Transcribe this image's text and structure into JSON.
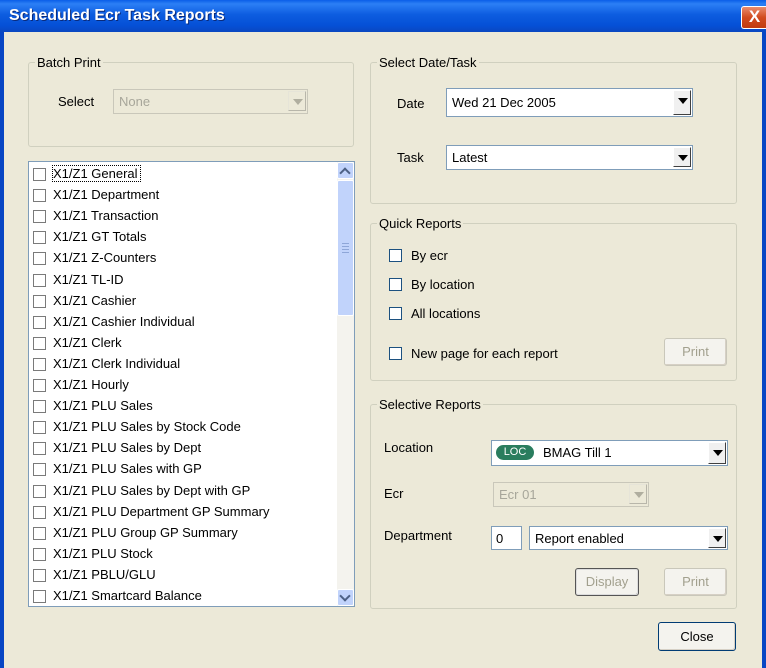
{
  "window": {
    "title": "Scheduled Ecr Task Reports",
    "close_glyph": "X"
  },
  "batch_print": {
    "legend": "Batch Print",
    "select_label": "Select",
    "select_value": "None"
  },
  "report_list": {
    "items": [
      "X1/Z1 General",
      "X1/Z1 Department",
      "X1/Z1 Transaction",
      "X1/Z1 GT Totals",
      "X1/Z1 Z-Counters",
      "X1/Z1 TL-ID",
      "X1/Z1 Cashier",
      "X1/Z1 Cashier Individual",
      "X1/Z1 Clerk",
      "X1/Z1 Clerk Individual",
      "X1/Z1 Hourly",
      "X1/Z1 PLU Sales",
      "X1/Z1 PLU Sales by Stock Code",
      "X1/Z1 PLU Sales by Dept",
      "X1/Z1 PLU Sales with GP",
      "X1/Z1 PLU Sales by Dept with GP",
      "X1/Z1 PLU Department GP Summary",
      "X1/Z1 PLU Group GP Summary",
      "X1/Z1 PLU Stock",
      "X1/Z1 PBLU/GLU",
      "X1/Z1 Smartcard Balance"
    ]
  },
  "date_task": {
    "legend": "Select Date/Task",
    "date_label": "Date",
    "date_value": "Wed 21 Dec 2005",
    "task_label": "Task",
    "task_value": "Latest"
  },
  "quick_reports": {
    "legend": "Quick Reports",
    "by_ecr": "By ecr",
    "by_location": "By location",
    "all_locations": "All locations",
    "new_page": "New page for each report",
    "print_label": "Print"
  },
  "selective_reports": {
    "legend": "Selective Reports",
    "location_label": "Location",
    "location_badge": "LOC",
    "location_value": "BMAG Till 1",
    "ecr_label": "Ecr",
    "ecr_value": "Ecr 01",
    "department_label": "Department",
    "department_number": "0",
    "department_value": "Report enabled",
    "display_label": "Display",
    "print_label": "Print"
  },
  "footer": {
    "close_label": "Close"
  }
}
